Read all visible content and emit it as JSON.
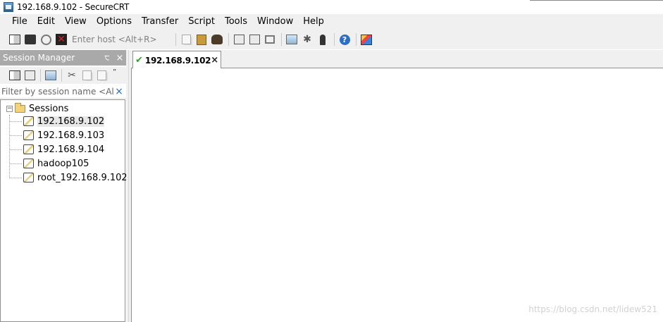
{
  "window": {
    "title": "192.168.9.102 - SecureCRT"
  },
  "menubar": {
    "items": [
      "File",
      "Edit",
      "View",
      "Options",
      "Transfer",
      "Script",
      "Tools",
      "Window",
      "Help"
    ]
  },
  "toolbar": {
    "host_placeholder": "Enter host <Alt+R>",
    "icons": [
      "connect-icon",
      "quick-connect-icon",
      "reconnect-icon",
      "disconnect-icon",
      "copy-icon",
      "paste-icon",
      "find-icon",
      "print-icon",
      "print-selection-icon",
      "sftp-icon",
      "session-options-icon",
      "keymap-icon",
      "key-agent-icon",
      "help-icon",
      "chart-icon"
    ]
  },
  "session_manager": {
    "title": "Session Manager",
    "pin_glyph": "੮",
    "close_glyph": "×",
    "filter_placeholder": "Filter by session name <Alt",
    "clear_glyph": "×",
    "more_glyph": "”",
    "root": {
      "label": "Sessions",
      "expander": "−"
    },
    "sessions": [
      {
        "label": "192.168.9.102",
        "selected": true
      },
      {
        "label": "192.168.9.103",
        "selected": false
      },
      {
        "label": "192.168.9.104",
        "selected": false
      },
      {
        "label": "hadoop105",
        "selected": false
      },
      {
        "label": "root_192.168.9.102",
        "selected": false
      }
    ]
  },
  "tabs": [
    {
      "label": "192.168.9.102",
      "status": "connected",
      "close_glyph": "×"
    }
  ],
  "terminal": {
    "watermark": "https://blog.csdn.net/lidew521"
  },
  "colors": {
    "panel_header": "#a9a9a9",
    "toolbar_bg": "#f0f0f0",
    "connected_check": "#32a02a",
    "clear_button": "#2a6ab3"
  }
}
